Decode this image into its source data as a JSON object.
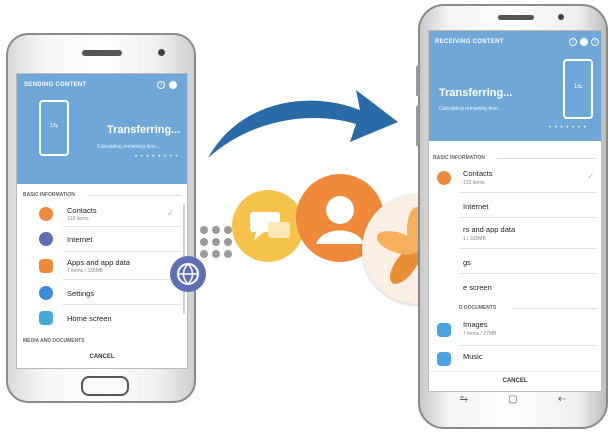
{
  "sending": {
    "header_title": "SENDING CONTENT",
    "header_icons": [
      "info-icon",
      "menu-icon"
    ],
    "device_label": "1⇆",
    "status": "Transferring...",
    "sub_status": "Calculating remaining time...",
    "section_basic": "BASIC INFORMATION",
    "items": [
      {
        "label": "Contacts",
        "sub": "133 items",
        "icon": "contacts-icon",
        "color": "#f08a3a",
        "checked": true
      },
      {
        "label": "Internet",
        "sub": "",
        "icon": "internet-icon",
        "color": "#5f6fb5",
        "checked": false
      },
      {
        "label": "Apps and app data",
        "sub": "7 items / 335MB",
        "icon": "apps-icon",
        "color": "#f08a3a",
        "checked": false
      },
      {
        "label": "Settings",
        "sub": "",
        "icon": "settings-icon",
        "color": "#3c8bd6",
        "checked": false
      },
      {
        "label": "Home screen",
        "sub": "",
        "icon": "home-screen-icon",
        "color": "#43a9d8",
        "checked": false
      }
    ],
    "section_media": "MEDIA AND DOCUMENTS",
    "cancel": "CANCEL"
  },
  "receiving": {
    "header_title": "RECEIVING CONTENT",
    "header_icons": [
      "info-icon",
      "menu-icon",
      "status-icon"
    ],
    "device_label": "1⇆",
    "status": "Transferring...",
    "sub_status": "Calculating remaining time...",
    "section_basic": "BASIC INFORMATION",
    "items": [
      {
        "label": "Contacts",
        "sub": "133 items",
        "icon": "contacts-icon",
        "color": "#f08a3a",
        "checked": true
      },
      {
        "label": "Internet",
        "sub": "",
        "icon": "internet-icon",
        "color": "#5f6fb5",
        "checked": false
      },
      {
        "label": "rs and app data",
        "sub": "1 / 335MB",
        "icon": "apps-icon",
        "color": "#f08a3a",
        "checked": false
      },
      {
        "label": "gs",
        "sub": "",
        "icon": "settings-icon",
        "color": "#3c8bd6",
        "checked": false
      },
      {
        "label": "e screen",
        "sub": "",
        "icon": "home-screen-icon",
        "color": "#43a9d8",
        "checked": false
      }
    ],
    "section_media": "D DOCUMENTS",
    "media_items": [
      {
        "label": "Images",
        "sub": "7 items / 27MB",
        "icon": "images-icon",
        "color": "#4aa3df"
      },
      {
        "label": "Music",
        "sub": "",
        "icon": "music-icon",
        "color": "#4aa3df"
      }
    ],
    "cancel": "CANCEL",
    "nav": [
      "recent-apps-icon",
      "home-icon",
      "back-icon"
    ]
  },
  "accent_colors": {
    "header": "#6fa7d9",
    "arrow": "#2a6aa6",
    "orange": "#f08a3a",
    "yellow": "#f5c24a"
  }
}
